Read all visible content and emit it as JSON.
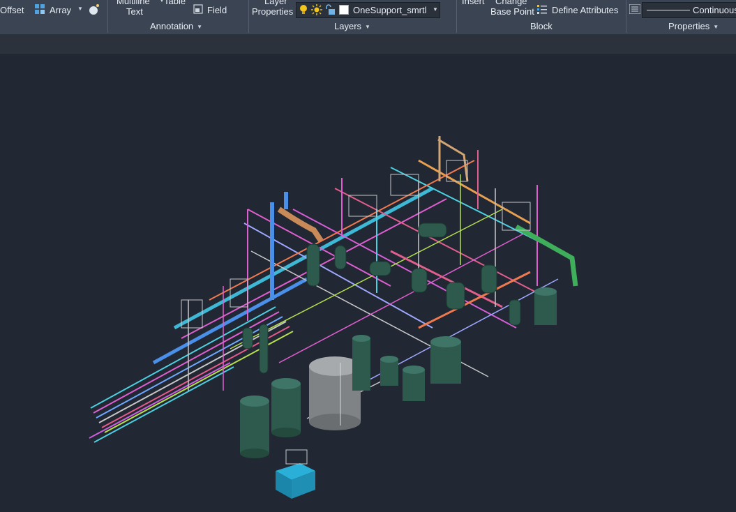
{
  "ribbon": {
    "modify": {
      "offset_label": "Offset",
      "array_label": "Array"
    },
    "annotation": {
      "multiline_label_top": "Multiline",
      "multiline_label_bottom": "Text",
      "table_label": "Table",
      "field_label": "Field",
      "panel_title": "Annotation"
    },
    "layers": {
      "layer_properties_top": "Layer",
      "layer_properties_bottom": "Properties",
      "current_layer": "OneSupport_smrtl",
      "panel_title": "Layers"
    },
    "block": {
      "insert_label": "Insert",
      "change_base_top": "Change",
      "change_base_bottom": "Base Point",
      "define_attributes_label": "Define Attributes",
      "panel_title": "Block"
    },
    "properties": {
      "linetype_value": "Continuous",
      "panel_title": "Properties"
    }
  },
  "colors": {
    "ribbon_bg": "#3b4453",
    "viewport_bg": "#212733",
    "tank_green": "#2d5a4c",
    "tank_gray": "#8c9094",
    "box_cyan": "#1f8fb3"
  }
}
